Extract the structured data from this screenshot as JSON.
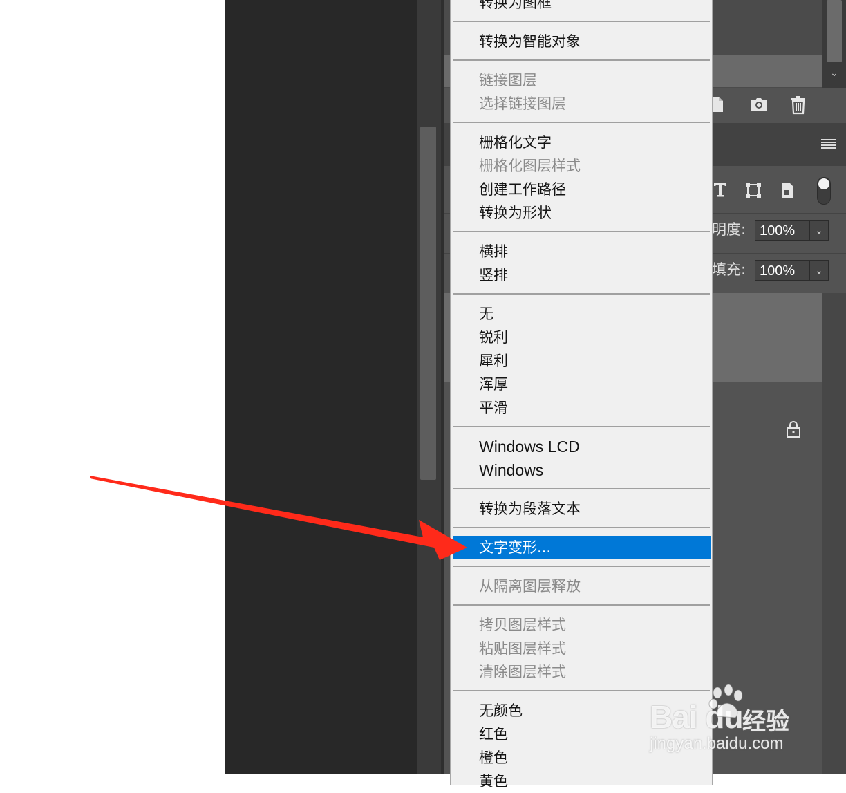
{
  "context_menu": {
    "items": [
      {
        "label": "转换为图框",
        "enabled": true
      },
      {
        "label": "转换为智能对象",
        "enabled": true
      },
      {
        "label": "链接图层",
        "enabled": false
      },
      {
        "label": "选择链接图层",
        "enabled": false
      },
      {
        "label": "栅格化文字",
        "enabled": true
      },
      {
        "label": "栅格化图层样式",
        "enabled": false
      },
      {
        "label": "创建工作路径",
        "enabled": true
      },
      {
        "label": "转换为形状",
        "enabled": true
      },
      {
        "label": "横排",
        "enabled": true
      },
      {
        "label": "竖排",
        "enabled": true
      },
      {
        "label": "无",
        "enabled": true
      },
      {
        "label": "锐利",
        "enabled": true
      },
      {
        "label": "犀利",
        "enabled": true
      },
      {
        "label": "浑厚",
        "enabled": true
      },
      {
        "label": "平滑",
        "enabled": true
      },
      {
        "label": "Windows LCD",
        "enabled": true
      },
      {
        "label": "Windows",
        "enabled": true
      },
      {
        "label": "转换为段落文本",
        "enabled": true
      },
      {
        "label": "文字变形...",
        "enabled": true,
        "highlighted": true
      },
      {
        "label": "从隔离图层释放",
        "enabled": false
      },
      {
        "label": "拷贝图层样式",
        "enabled": false
      },
      {
        "label": "粘贴图层样式",
        "enabled": false
      },
      {
        "label": "清除图层样式",
        "enabled": false
      },
      {
        "label": "无颜色",
        "enabled": true
      },
      {
        "label": "红色",
        "enabled": true
      },
      {
        "label": "橙色",
        "enabled": true
      },
      {
        "label": "黄色",
        "enabled": true
      }
    ]
  },
  "layers_panel": {
    "opacity_label": "明度:",
    "opacity_value": "100%",
    "fill_label": "填充:",
    "fill_value": "100%",
    "filter_icons": [
      "type-icon",
      "transform-icon",
      "smart-object-icon"
    ],
    "bottom_icons": [
      "new-layer-icon",
      "camera-icon",
      "trash-icon"
    ],
    "lock_icon": "lock-icon"
  },
  "annotation": {
    "arrow_color": "#ff2a1a"
  },
  "watermark": {
    "logo": "Bai du",
    "product": "经验",
    "url": "jingyan.baidu.com"
  },
  "colors": {
    "highlight": "#0078d7",
    "menu_bg": "#f0f0f0",
    "panel_bg": "#535353"
  }
}
